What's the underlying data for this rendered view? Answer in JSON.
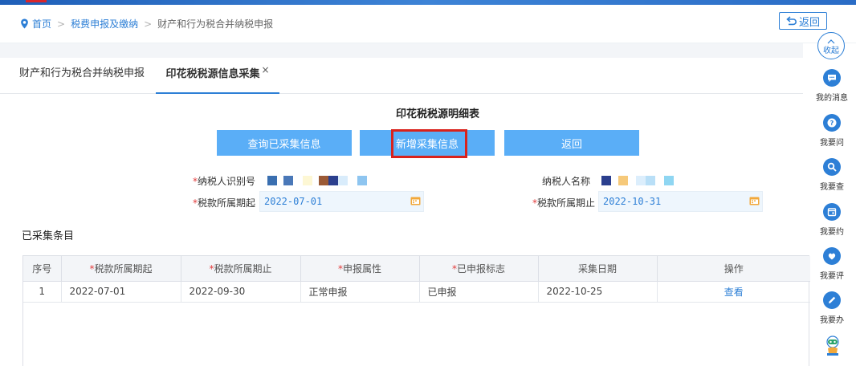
{
  "breadcrumb": {
    "home": "首页",
    "level2": "税费申报及缴纳",
    "current": "财产和行为税合并纳税申报"
  },
  "back_button": "返回",
  "tabs": [
    {
      "label": "财产和行为税合并纳税申报",
      "active": false
    },
    {
      "label": "印花税税源信息采集",
      "active": true,
      "close": "×"
    }
  ],
  "sheet_title": "印花税税源明细表",
  "buttons": {
    "query": "查询已采集信息",
    "new": "新增采集信息",
    "return": "返回"
  },
  "form": {
    "taxpayer_id_label": "纳税人识别号",
    "taxpayer_name_label": "纳税人名称",
    "period_start_label": "税款所属期起",
    "period_start_value": "2022-07-01",
    "period_end_label": "税款所属期止",
    "period_end_value": "2022-10-31",
    "required_mark": "*"
  },
  "section_title": "已采集条目",
  "table": {
    "headers": [
      "序号",
      "税款所属期起",
      "税款所属期止",
      "申报属性",
      "已申报标志",
      "采集日期",
      "操作"
    ],
    "rows": [
      {
        "index": "1",
        "start": "2022-07-01",
        "end": "2022-09-30",
        "attr": "正常申报",
        "flag": "已申报",
        "date": "2022-10-25",
        "action": "查看"
      }
    ]
  },
  "sidebar": {
    "collapse": "收起",
    "items": [
      {
        "label": "我的消息",
        "icon": "message-icon"
      },
      {
        "label": "我要问",
        "icon": "question-icon"
      },
      {
        "label": "我要查",
        "icon": "search-icon"
      },
      {
        "label": "我要约",
        "icon": "appointment-icon"
      },
      {
        "label": "我要评",
        "icon": "rate-icon"
      },
      {
        "label": "我要办",
        "icon": "edit-icon"
      }
    ]
  },
  "colors": {
    "primary": "#2d7fd6",
    "button": "#5aaef7",
    "required": "#e23c3c",
    "highlight": "#d9221c"
  }
}
